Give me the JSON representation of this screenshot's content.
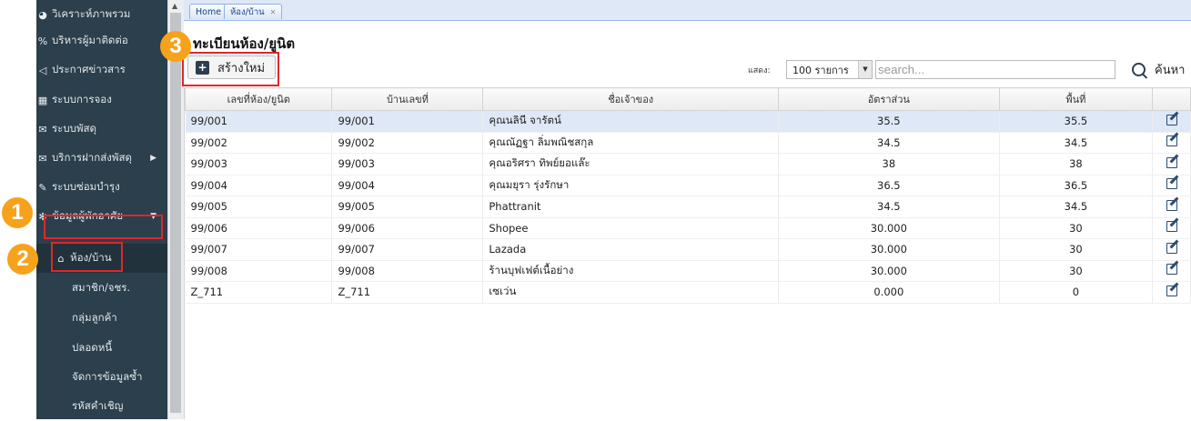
{
  "sidebar": {
    "items": [
      {
        "icon": "chart-icon",
        "glyph": "◕",
        "label": "วิเคราะห์ภาพรวม"
      },
      {
        "icon": "contacts-icon",
        "glyph": "%",
        "label": "บริหารผู้มาติดต่อ"
      },
      {
        "icon": "megaphone-icon",
        "glyph": "◁",
        "label": "ประกาศข่าวสาร"
      },
      {
        "icon": "calendar-icon",
        "glyph": "▦",
        "label": "ระบบการจอง"
      },
      {
        "icon": "envelope-icon",
        "glyph": "✉",
        "label": "ระบบพัสดุ"
      },
      {
        "icon": "envelope-icon",
        "glyph": "✉",
        "label": "บริการฝากส่งพัสดุ"
      },
      {
        "icon": "wrench-icon",
        "glyph": "✎",
        "label": "ระบบซ่อมบำรุง"
      },
      {
        "icon": "residents-icon",
        "glyph": "✻",
        "label": "ข้อมูลผู้พักอาศัย"
      }
    ],
    "submenu": [
      {
        "icon": "home-icon",
        "glyph": "⌂",
        "label": "ห้อง/บ้าน"
      },
      {
        "label": "สมาชิก/จชร."
      },
      {
        "label": "กลุ่มลูกค้า"
      },
      {
        "label": "ปลอดหนี้"
      },
      {
        "label": "จัดการข้อมูลซ้ำ"
      },
      {
        "label": "รหัสคำเชิญ"
      }
    ]
  },
  "tabs": [
    {
      "label": "Home"
    },
    {
      "label": "ห้อง/บ้าน"
    }
  ],
  "page": {
    "title": "ทะเบียนห้อง/ยูนิต",
    "create_button": "สร้างใหม่",
    "show_label": "แสดง:",
    "page_size": "100 รายการ",
    "search_placeholder": "search...",
    "search_button": "ค้นหา"
  },
  "table": {
    "columns": [
      "เลขที่ห้อง/ยูนิต",
      "บ้านเลขที่",
      "ชื่อเจ้าของ",
      "อัตราส่วน",
      "พื้นที่",
      ""
    ],
    "rows": [
      [
        "99/001",
        "99/001",
        "คุณนลินี จารัตน์",
        "35.5",
        "35.5"
      ],
      [
        "99/002",
        "99/002",
        "คุณณัฏฐา ลิ่มพณิชสกุล",
        "34.5",
        "34.5"
      ],
      [
        "99/003",
        "99/003",
        "คุณอริศรา ทิพย์ยอแล๊ะ",
        "38",
        "38"
      ],
      [
        "99/004",
        "99/004",
        "คุณมยุรา รุ่งรักษา",
        "36.5",
        "36.5"
      ],
      [
        "99/005",
        "99/005",
        "Phattranit",
        "34.5",
        "34.5"
      ],
      [
        "99/006",
        "99/006",
        "Shopee",
        "30.000",
        "30"
      ],
      [
        "99/007",
        "99/007",
        "Lazada",
        "30.000",
        "30"
      ],
      [
        "99/008",
        "99/008",
        "ร้านบุฟเฟต์เนื้อย่าง",
        "30.000",
        "30"
      ],
      [
        "Z_711",
        "Z_711",
        "เซเว่น",
        "0.000",
        "0"
      ]
    ]
  },
  "annotations": [
    "1",
    "2",
    "3"
  ],
  "colors": {
    "sidebar_bg": "#2b3f4c",
    "badge": "#f7a21b",
    "highlight": "#e0262d",
    "selected_row": "#dfe8f6"
  }
}
